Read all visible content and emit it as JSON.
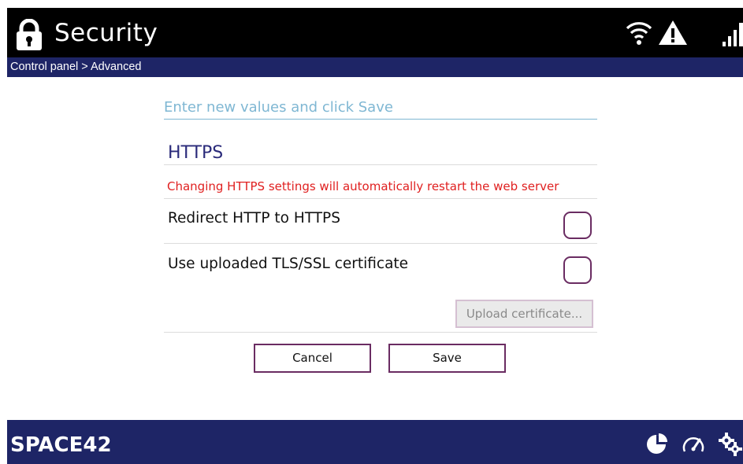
{
  "header": {
    "title": "Security",
    "icons": [
      "lock-icon",
      "wifi-icon",
      "warning-icon",
      "signal-icon"
    ]
  },
  "breadcrumb": "Control panel > Advanced",
  "form": {
    "instruction": "Enter new values and click Save",
    "section_title": "HTTPS",
    "warning": "Changing HTTPS settings will automatically restart the web server",
    "options": [
      {
        "label": "Redirect HTTP to HTTPS",
        "checked": false
      },
      {
        "label": "Use uploaded TLS/SSL certificate",
        "checked": false
      }
    ],
    "upload_label": "Upload certificate...",
    "cancel_label": "Cancel",
    "save_label": "Save"
  },
  "footer": {
    "logo_text": "SPACE42",
    "icons": [
      "pie-chart-icon",
      "speedometer-icon",
      "gears-icon"
    ]
  },
  "colors": {
    "header_bg": "#000000",
    "bar_bg": "#1e2566",
    "accent": "#6a2c62",
    "warning": "#e02020",
    "instruction": "#7fb7d3",
    "section_title": "#2a2a7a"
  }
}
